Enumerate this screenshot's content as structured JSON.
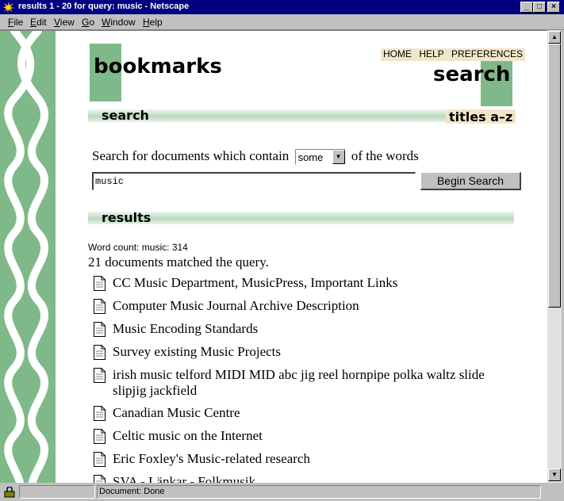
{
  "window": {
    "title": "results 1 - 20 for query: music - Netscape"
  },
  "menu": [
    "File",
    "Edit",
    "View",
    "Go",
    "Window",
    "Help"
  ],
  "header": {
    "logo": "bookmarks",
    "section": "search",
    "nav": [
      "HOME",
      "HELP",
      "PREFERENCES"
    ]
  },
  "bars": {
    "search": "search",
    "titles": "titles a–z",
    "results": "results"
  },
  "form": {
    "prefix": "Search for documents which contain",
    "mode": "some",
    "suffix": "of the words",
    "query": "music",
    "submit": "Begin Search"
  },
  "results": {
    "word_count": "Word count: music: 314",
    "matched": "21 documents matched the query.",
    "items": [
      "CC Music Department, MusicPress, Important Links",
      "Computer Music Journal Archive Description",
      "Music Encoding Standards",
      "Survey existing Music Projects",
      "irish music telford MIDI MID abc jig reel hornpipe polka waltz slide slipjig jackfield",
      "Canadian Music Centre",
      "Celtic music on the Internet",
      "Eric Foxley's Music-related research",
      "SVA - Länkar - Folkmusik"
    ]
  },
  "status": {
    "text": "Document: Done"
  },
  "colors": {
    "accent": "#7fb98a",
    "nav_bg": "#f2e6c8",
    "titlebar": "#000080"
  }
}
